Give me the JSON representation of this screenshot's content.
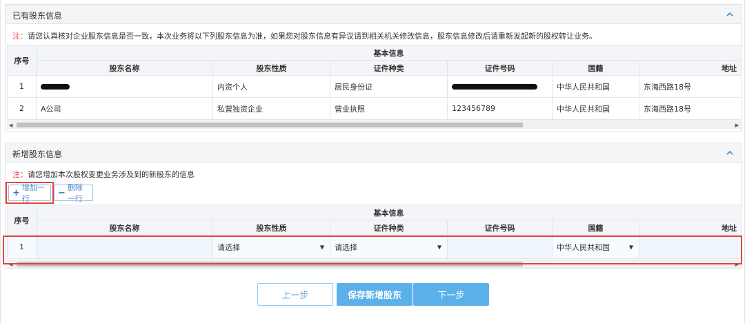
{
  "existing": {
    "title": "已有股东信息",
    "note_prefix": "注：",
    "note_text": "请您认真核对企业股东信息是否一致，本次业务将以下列股东信息为准，如果您对股东信息有异议请到相关机关修改信息，股东信息修改后请重新发起新的股权转让业务。",
    "group_header": "基本信息",
    "columns": [
      "序号",
      "股东名称",
      "股东性质",
      "证件种类",
      "证件号码",
      "国籍",
      "地址"
    ],
    "rows": [
      {
        "index": "1",
        "name": "",
        "name_redacted": true,
        "type": "内资个人",
        "id_type": "居民身份证",
        "id_no": "",
        "id_redacted": true,
        "nationality": "中华人民共和国",
        "address": "东海西路18号"
      },
      {
        "index": "2",
        "name": "A公司",
        "name_redacted": false,
        "type": "私营独资企业",
        "id_type": "营业执照",
        "id_no": "123456789",
        "id_redacted": false,
        "nationality": "中华人民共和国",
        "address": "东海西路18号"
      }
    ]
  },
  "new": {
    "title": "新增股东信息",
    "note_prefix": "注：",
    "note_text": "请您增加本次股权变更业务涉及到的新股东的信息",
    "add_row_label": "增加一行",
    "delete_row_label": "删除一行",
    "group_header": "基本信息",
    "columns": [
      "序号",
      "股东名称",
      "股东性质",
      "证件种类",
      "证件号码",
      "国籍",
      "地址"
    ],
    "rows": [
      {
        "index": "1",
        "name": "",
        "type_selected": "请选择",
        "id_type_selected": "请选择",
        "id_no": "",
        "nationality_selected": "中华人民共和国",
        "address": ""
      }
    ]
  },
  "actions": {
    "prev": "上一步",
    "save": "保存新增股东",
    "next": "下一步"
  },
  "icons": {
    "collapse": "chevron-up-icon",
    "add": "plus-icon",
    "remove": "minus-icon",
    "dropdown": "caret-down-icon"
  },
  "colors": {
    "accent": "#5cb0ea",
    "highlight": "#e8403d",
    "note_red": "#e64340"
  }
}
